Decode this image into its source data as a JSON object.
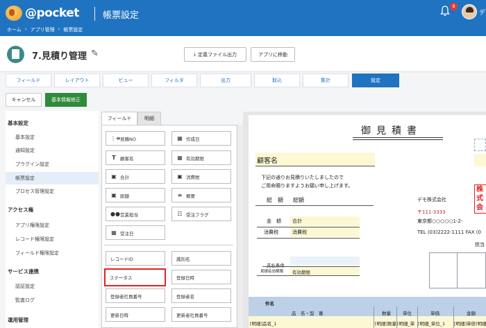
{
  "header": {
    "logo_text": "@pocket",
    "page_heading": "帳票設定",
    "breadcrumbs": [
      "ホーム",
      "›",
      "アプリ管理",
      "›",
      "帳票設定"
    ],
    "notification_count": "8",
    "user_name": "デ"
  },
  "app": {
    "title": "7.見積り管理",
    "export_button": "定義ファイル出力",
    "move_button": "アプリに移動"
  },
  "tabs": [
    {
      "label": "フィールド",
      "active": false
    },
    {
      "label": "レイアウト",
      "active": false
    },
    {
      "label": "ビュー",
      "active": false
    },
    {
      "label": "フィルタ",
      "active": false
    },
    {
      "label": "出力",
      "active": false
    },
    {
      "label": "取込",
      "active": false
    },
    {
      "label": "集計",
      "active": false
    },
    {
      "label": "設定",
      "active": true
    }
  ],
  "actions": {
    "cancel": "キャンセル",
    "save": "基本情報修正"
  },
  "sidebar": {
    "sections": [
      {
        "title": "基本設定",
        "items": [
          "基本設定",
          "通知設定",
          "プラグイン設定",
          "帳票設定",
          "プロセス管理設定"
        ]
      },
      {
        "title": "アクセス権",
        "items": [
          "アプリ権限設定",
          "レコード権限設定",
          "フィールド権限設定"
        ]
      },
      {
        "title": "サービス連携",
        "items": [
          "認証設定",
          "監査ログ"
        ]
      },
      {
        "title": "運用管理",
        "items": []
      }
    ],
    "active_item": "帳票設定"
  },
  "palette": {
    "tabs": [
      "フィールド",
      "明細"
    ],
    "fields": [
      {
        "label": "見積NO",
        "icon": "list-number-icon"
      },
      {
        "label": "作成日",
        "icon": "calendar-icon"
      },
      {
        "label": "顧客名",
        "icon": "text-icon"
      },
      {
        "label": "有効期限",
        "icon": "calendar-icon"
      },
      {
        "label": "合計",
        "icon": "calculator-icon"
      },
      {
        "label": "消費税",
        "icon": "calculator-icon"
      },
      {
        "label": "総額",
        "icon": "calculator-icon"
      },
      {
        "label": "概要",
        "icon": "lines-icon"
      },
      {
        "label": "営業担当",
        "icon": "users-icon"
      },
      {
        "label": "受注フラグ",
        "icon": "checkbox-list-icon"
      },
      {
        "label": "受注日",
        "icon": "calendar-icon"
      }
    ],
    "system_fields": [
      "レコードID",
      "識別名",
      "ステータス",
      "登録日時",
      "登録者社員番号",
      "登録者名",
      "更新日時",
      "更新者社員番号"
    ],
    "highlighted": "ステータス"
  },
  "preview": {
    "title": "御見積書",
    "customer_label": "顧客名",
    "intro_1": "下記の通りお見積りいたしましたので",
    "intro_2": "ご用命賜りますようお願い申し上げます。",
    "total_label": "総　額",
    "total_value": "総額",
    "amount_label": "金　額",
    "amount_value": "合計",
    "tax_label": "消費税",
    "tax_value": "消費税",
    "company": "デモ株式会社",
    "postal": "〒111-3333",
    "address": "東京都○○○○○1-2-",
    "tel": "TEL (03)2222-1111 FAX (0",
    "person": "担当",
    "payment_label": "支払条件",
    "validity_label": "見積有効期限",
    "validity_value": "有効期限",
    "stamp_text": "株式会社",
    "table_title": "件名",
    "columns": [
      "品　名・型　番",
      "数量",
      "単位",
      "単価",
      "金額"
    ],
    "row_cells": [
      "[明細]品名_1",
      "[明細]数量",
      "[明細_単",
      "[明細_単位_1",
      "[明細]単価",
      "[明細]金"
    ]
  }
}
